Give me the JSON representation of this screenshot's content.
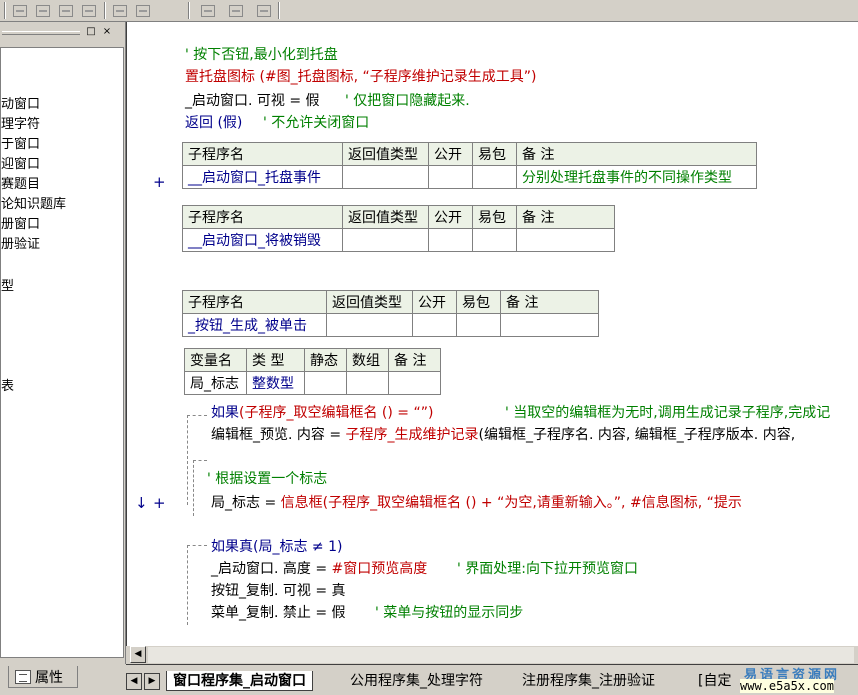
{
  "toolbar": {
    "icons": [
      "align-left-icon",
      "align-center-icon",
      "align-right-icon",
      "align-justify-icon",
      "same-width-icon",
      "same-height-icon",
      "h-spacing-icon",
      "v-spacing-icon",
      "center-icon"
    ]
  },
  "left_panel": {
    "pin_label": "□",
    "close_label": "×",
    "tree_items": [
      "动窗口",
      "理字符",
      "于窗口",
      "迎窗口",
      "赛题目",
      "论知识题库",
      "册窗口",
      "册验证",
      "型",
      "表"
    ],
    "bottom_tab_label": "属性"
  },
  "editor": {
    "lines_top": [
      {
        "text": "' 按下否钮,最小化到托盘",
        "style": "comment"
      },
      {
        "text": "置托盘图标 (#图_托盘图标, “子程序维护记录生成工具”)",
        "style": "red"
      },
      {
        "text": "_启动窗口. 可视 = 假",
        "style": "black"
      },
      {
        "text": "' 仅把窗口隐藏起来.",
        "style": "comment"
      },
      {
        "text": "返回 (假)",
        "style": "blue"
      },
      {
        "text": "' 不允许关闭窗口",
        "style": "comment"
      }
    ],
    "sub_headers": [
      "子程序名",
      "返回值类型",
      "公开",
      "易包",
      "备 注"
    ],
    "sub1": {
      "name": "__启动窗口_托盘事件",
      "ret": "",
      "pub": "",
      "pkg": "",
      "note": "分别处理托盘事件的不同操作类型"
    },
    "sub2": {
      "name": "__启动窗口_将被销毁",
      "ret": "",
      "pub": "",
      "pkg": "",
      "note": ""
    },
    "sub3": {
      "name": "_按钮_生成_被单击",
      "ret": "",
      "pub": "",
      "pkg": "",
      "note": ""
    },
    "var_headers": [
      "变量名",
      "类 型",
      "静态",
      "数组",
      "备 注"
    ],
    "var1": {
      "name": "局_标志",
      "type": "整数型",
      "static": "",
      "array": "",
      "note": ""
    },
    "code": {
      "if1_kw": "如果",
      "if1_cond": "(子程序_取空编辑框名 () = “”)",
      "if1_comment": "' 当取空的编辑框为无时,调用生成记录子程序,完成记",
      "line2_a": "编辑框_预览. 内容 = ",
      "line2_b": "子程序_生成维护记录",
      "line2_c": "(编辑框_子程序名. 内容, 编辑框_子程序版本. 内容,",
      "flag_comment": "' 根据设置一个标志",
      "line4_a": "局_标志 = ",
      "line4_b": "信息框",
      "line4_c": "(子程序_取空编辑框名 () + “为空,请重新输入。”, #信息图标, “提示",
      "if2_kw": "如果真",
      "if2_cond": "(局_标志 ≠ 1)",
      "line6_a": "_启动窗口. 高度 = ",
      "line6_b": "#窗口预览高度",
      "line6_c": "' 界面处理:向下拉开预览窗口",
      "line7": "按钮_复制. 可视 = 真",
      "line8_a": "菜单_复制. 禁止 = 假",
      "line8_b": "' 菜单与按钮的显示同步"
    },
    "gutter": {
      "plus": "+",
      "arrow": "↓"
    }
  },
  "tabs": {
    "items": [
      "窗口程序集_启动窗口",
      "公用程序集_处理字符",
      "注册程序集_注册验证",
      "[自定"
    ],
    "active_index": 0
  },
  "watermark": {
    "line1": "易语言资源网",
    "line2": "www.e5a5x.com"
  }
}
